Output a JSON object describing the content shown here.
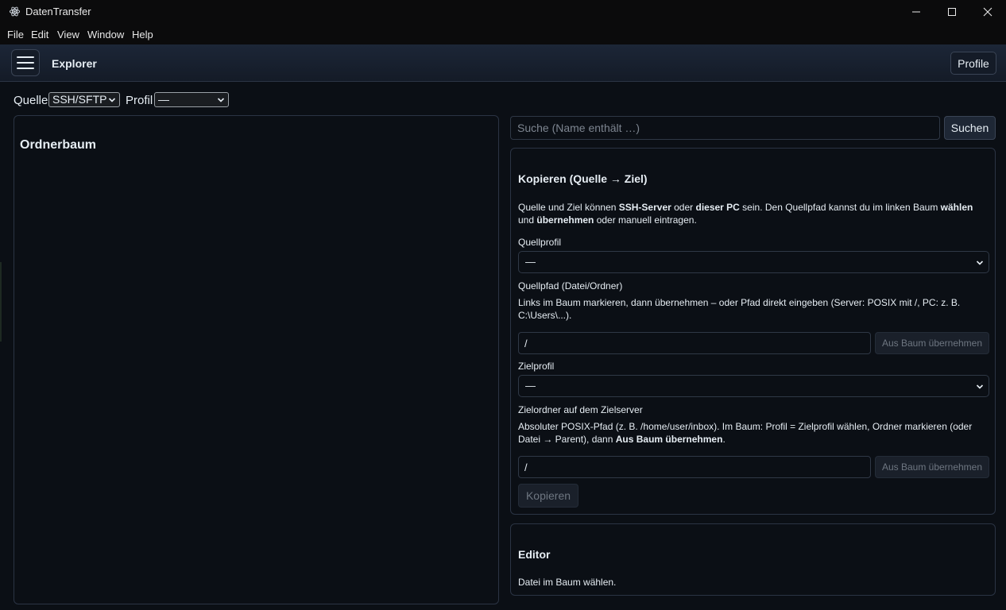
{
  "window": {
    "title": "DatenTransfer",
    "menu": [
      "File",
      "Edit",
      "View",
      "Window",
      "Help"
    ]
  },
  "header": {
    "title": "Explorer",
    "profile_label": "Profile"
  },
  "source_row": {
    "source_label": "Quelle",
    "source_value": "SSH/SFTP",
    "profile_label": "Profil",
    "profile_value": "—"
  },
  "tree": {
    "title": "Ordnerbaum"
  },
  "search": {
    "placeholder": "Suche (Name enthält …)",
    "button_label": "Suchen"
  },
  "copy": {
    "title": "Kopieren (Quelle → Ziel)",
    "intro": {
      "t1": "Quelle und Ziel können ",
      "b1": "SSH-Server",
      "t2": " oder ",
      "b2": "dieser PC",
      "t3": " sein. Den Quellpfad kannst du im linken Baum ",
      "b3": "wählen",
      "t4": " und ",
      "b4": "übernehmen",
      "t5": " oder manuell eintragen."
    },
    "source_profile_label": "Quellprofil",
    "source_profile_value": "—",
    "source_path_label": "Quellpfad (Datei/Ordner)",
    "source_path_help": "Links im Baum markieren, dann übernehmen – oder Pfad direkt eingeben (Server: POSIX mit /, PC: z. B. C:\\Users\\...).",
    "source_path_value": "/",
    "take_from_tree_label": "Aus Baum übernehmen",
    "target_profile_label": "Zielprofil",
    "target_profile_value": "—",
    "target_folder_label": "Zielordner auf dem Zielserver",
    "target_folder_help": {
      "t1": "Absoluter POSIX-Pfad (z. B. /home/user/inbox). Im Baum: Profil = Zielprofil wählen, Ordner markieren (oder Datei → Parent), dann ",
      "b1": "Aus Baum übernehmen",
      "t2": "."
    },
    "target_folder_value": "/",
    "copy_button_label": "Kopieren"
  },
  "editor": {
    "title": "Editor",
    "hint": "Datei im Baum wählen."
  },
  "colors": {
    "background": "#0b0f15",
    "border": "#2b3444",
    "text": "#e6edf3",
    "muted": "#6e7681"
  }
}
